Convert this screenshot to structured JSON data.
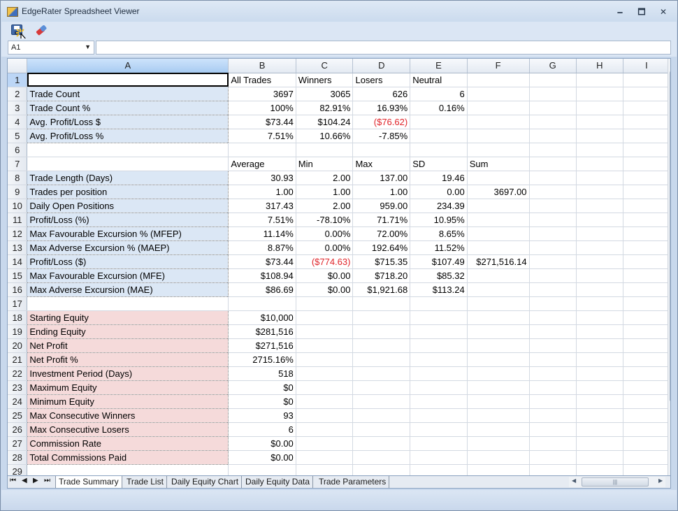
{
  "window": {
    "title": "EdgeRater Spreadsheet Viewer",
    "minimize_glyph": "🗕",
    "maximize_glyph": "🗖",
    "close_glyph": "✕"
  },
  "toolbar": {
    "save_icon": "save-disk-icon",
    "clear_icon": "eraser-icon"
  },
  "formula_bar": {
    "cell_ref": "A1",
    "formula": ""
  },
  "grid": {
    "columns": [
      "A",
      "B",
      "C",
      "D",
      "E",
      "F",
      "G",
      "H",
      "I"
    ],
    "rows": [
      {
        "n": "1",
        "cells": [
          "",
          "All Trades",
          "Winners",
          "Losers",
          "Neutral",
          "",
          "",
          "",
          ""
        ]
      },
      {
        "n": "2",
        "cells": [
          "Trade Count",
          "3697",
          "3065",
          "626",
          "6",
          "",
          "",
          "",
          ""
        ]
      },
      {
        "n": "3",
        "cells": [
          "Trade Count %",
          "100%",
          "82.91%",
          "16.93%",
          "0.16%",
          "",
          "",
          "",
          ""
        ]
      },
      {
        "n": "4",
        "cells": [
          "Avg. Profit/Loss $",
          "$73.44",
          "$104.24",
          "($76.62)",
          "",
          "",
          "",
          "",
          ""
        ]
      },
      {
        "n": "5",
        "cells": [
          "Avg. Profit/Loss %",
          "7.51%",
          "10.66%",
          "-7.85%",
          "",
          "",
          "",
          "",
          ""
        ]
      },
      {
        "n": "6",
        "cells": [
          "",
          "",
          "",
          "",
          "",
          "",
          "",
          "",
          ""
        ]
      },
      {
        "n": "7",
        "cells": [
          "",
          "Average",
          "Min",
          "Max",
          "SD",
          "Sum",
          "",
          "",
          ""
        ]
      },
      {
        "n": "8",
        "cells": [
          "Trade Length (Days)",
          "30.93",
          "2.00",
          "137.00",
          "19.46",
          "",
          "",
          "",
          ""
        ]
      },
      {
        "n": "9",
        "cells": [
          "Trades per position",
          "1.00",
          "1.00",
          "1.00",
          "0.00",
          "3697.00",
          "",
          "",
          ""
        ]
      },
      {
        "n": "10",
        "cells": [
          "Daily Open Positions",
          "317.43",
          "2.00",
          "959.00",
          "234.39",
          "",
          "",
          "",
          ""
        ]
      },
      {
        "n": "11",
        "cells": [
          "Profit/Loss (%)",
          "7.51%",
          "-78.10%",
          "71.71%",
          "10.95%",
          "",
          "",
          "",
          ""
        ]
      },
      {
        "n": "12",
        "cells": [
          "Max Favourable Excursion % (MFEP)",
          "11.14%",
          "0.00%",
          "72.00%",
          "8.65%",
          "",
          "",
          "",
          ""
        ]
      },
      {
        "n": "13",
        "cells": [
          "Max Adverse Excursion % (MAEP)",
          "8.87%",
          "0.00%",
          "192.64%",
          "11.52%",
          "",
          "",
          "",
          ""
        ]
      },
      {
        "n": "14",
        "cells": [
          "Profit/Loss ($)",
          "$73.44",
          "($774.63)",
          "$715.35",
          "$107.49",
          "$271,516.14",
          "",
          "",
          ""
        ]
      },
      {
        "n": "15",
        "cells": [
          "Max Favourable Excursion (MFE)",
          "$108.94",
          "$0.00",
          "$718.20",
          "$85.32",
          "",
          "",
          "",
          ""
        ]
      },
      {
        "n": "16",
        "cells": [
          "Max Adverse Excursion (MAE)",
          "$86.69",
          "$0.00",
          "$1,921.68",
          "$113.24",
          "",
          "",
          "",
          ""
        ]
      },
      {
        "n": "17",
        "cells": [
          "",
          "",
          "",
          "",
          "",
          "",
          "",
          "",
          ""
        ]
      },
      {
        "n": "18",
        "cells": [
          "Starting Equity",
          "$10,000",
          "",
          "",
          "",
          "",
          "",
          "",
          ""
        ]
      },
      {
        "n": "19",
        "cells": [
          "Ending Equity",
          "$281,516",
          "",
          "",
          "",
          "",
          "",
          "",
          ""
        ]
      },
      {
        "n": "20",
        "cells": [
          "Net Profit",
          "$271,516",
          "",
          "",
          "",
          "",
          "",
          "",
          ""
        ]
      },
      {
        "n": "21",
        "cells": [
          "Net Profit %",
          "2715.16%",
          "",
          "",
          "",
          "",
          "",
          "",
          ""
        ]
      },
      {
        "n": "22",
        "cells": [
          "Investment Period (Days)",
          "518",
          "",
          "",
          "",
          "",
          "",
          "",
          ""
        ]
      },
      {
        "n": "23",
        "cells": [
          "Maximum Equity",
          "$0",
          "",
          "",
          "",
          "",
          "",
          "",
          ""
        ]
      },
      {
        "n": "24",
        "cells": [
          "Minimum Equity",
          "$0",
          "",
          "",
          "",
          "",
          "",
          "",
          ""
        ]
      },
      {
        "n": "25",
        "cells": [
          "Max Consecutive Winners",
          "93",
          "",
          "",
          "",
          "",
          "",
          "",
          ""
        ]
      },
      {
        "n": "26",
        "cells": [
          "Max Consecutive Losers",
          "6",
          "",
          "",
          "",
          "",
          "",
          "",
          ""
        ]
      },
      {
        "n": "27",
        "cells": [
          "Commission Rate",
          "$0.00",
          "",
          "",
          "",
          "",
          "",
          "",
          ""
        ]
      },
      {
        "n": "28",
        "cells": [
          "Total Commissions Paid",
          "$0.00",
          "",
          "",
          "",
          "",
          "",
          "",
          ""
        ]
      },
      {
        "n": "29",
        "cells": [
          "",
          "",
          "",
          "",
          "",
          "",
          "",
          "",
          ""
        ]
      }
    ]
  },
  "sheet_tabs": [
    {
      "label": "Trade Summary"
    },
    {
      "label": "Trade List"
    },
    {
      "label": "Daily Equity Chart"
    },
    {
      "label": "Daily Equity Data"
    },
    {
      "label": "Trade Parameters"
    }
  ],
  "nav": {
    "first": "⏮",
    "prev": "◀",
    "next": "▶",
    "last": "⏭"
  },
  "scroll": {
    "up": "▲",
    "down": "▼",
    "left": "◀",
    "right": "▶",
    "grip_v": "≡",
    "grip_h": "|||"
  },
  "colors": {
    "header_label_bg": "#dbe7f5",
    "equity_label_bg": "#f5dada",
    "negative_text": "#e0242a",
    "selected_header": "#bcd6f6"
  }
}
